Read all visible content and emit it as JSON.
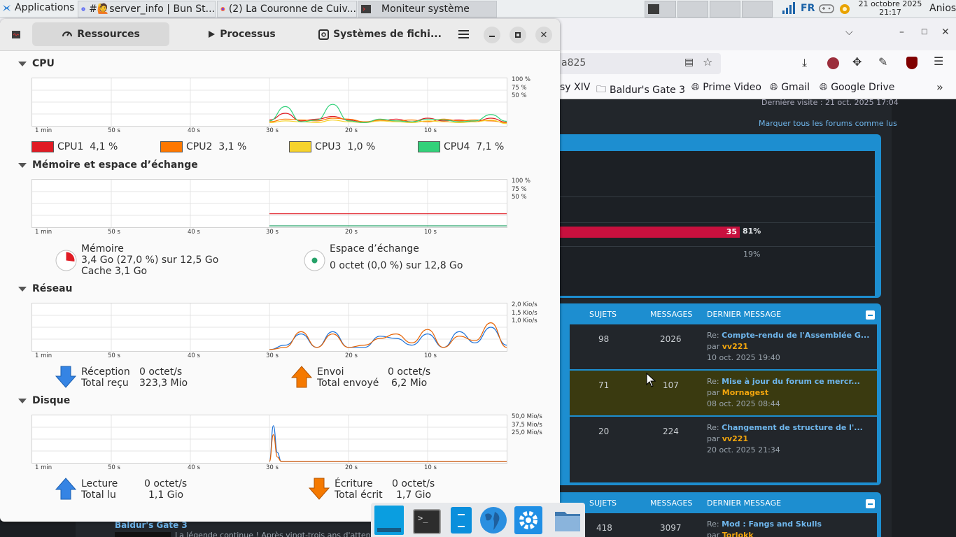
{
  "top_panel": {
    "applications_label": "Applications",
    "tasks": [
      {
        "label": "#🙋server_info | Bun St...",
        "icon": "discord-icon"
      },
      {
        "label": "(2) La Couronne de Cuiv...",
        "icon": "firefox-icon"
      },
      {
        "label": "Moniteur système",
        "icon": "terminal-icon"
      }
    ],
    "keyboard_layout": "FR",
    "clock_date": "21 octobre 2025",
    "clock_time": "21:17",
    "user_name": "Anios"
  },
  "firefox": {
    "url_fragment": "a825",
    "bookmarks": [
      "sy XIV",
      "Baldur's Gate 3",
      "Prime Video",
      "Gmail",
      "Google Drive"
    ],
    "last_visit": "Dernière visite : 21 oct. 2025 17:04",
    "mark_all_read": "Marquer tous les forums comme lus",
    "poll": [
      {
        "count": "35",
        "percent": "81%"
      },
      {
        "percent": "19%"
      }
    ],
    "headers": {
      "topics": "SUJETS",
      "messages": "MESSAGES",
      "last_message": "DERNIER MESSAGE"
    },
    "forum_rows": [
      {
        "topics": "98",
        "messages": "2026",
        "prefix": "Re:",
        "title": "Compte-rendu de l'Assemblée G...",
        "by": "par",
        "author": "vv221",
        "date": "10 oct. 2025 19:40"
      },
      {
        "topics": "71",
        "messages": "107",
        "prefix": "Re:",
        "title": "Mise à jour du forum ce mercr...",
        "by": "par",
        "author": "Mornagest",
        "date": "08 oct. 2025 08:44"
      },
      {
        "topics": "20",
        "messages": "224",
        "prefix": "Re:",
        "title": "Changement de structure de l'...",
        "by": "par",
        "author": "vv221",
        "date": "20 oct. 2025 21:34"
      }
    ],
    "second_block": {
      "topics": "418",
      "messages": "3097",
      "prefix": "Re:",
      "title": "Mod : Fangs and Skulls",
      "by": "par",
      "author": "Torlokk"
    },
    "forum_title_bottom": "Baldur's Gate 3",
    "forum_desc_bottom": "La légende continue ! Après vingt-trois ans d'attente, un..."
  },
  "sysmon": {
    "tabs": [
      {
        "label": "Ressources",
        "icon": "gauge-icon",
        "selected": true
      },
      {
        "label": "Processus",
        "icon": "play-icon",
        "selected": false
      },
      {
        "label": "Systèmes de fichi...",
        "icon": "disk-icon",
        "selected": false
      }
    ],
    "time_labels": [
      "1 min",
      "50 s",
      "40 s",
      "30 s",
      "20 s",
      "10 s"
    ],
    "cpu": {
      "title": "CPU",
      "y_labels": [
        "100 %",
        "75 %",
        "50 %"
      ],
      "legend": [
        {
          "name": "CPU1",
          "value": "4,1 %",
          "color": "#e01b24"
        },
        {
          "name": "CPU2",
          "value": "3,1 %",
          "color": "#ff7800"
        },
        {
          "name": "CPU3",
          "value": "1,0 %",
          "color": "#f6d32d"
        },
        {
          "name": "CPU4",
          "value": "7,1 %",
          "color": "#33d17a"
        }
      ]
    },
    "memory": {
      "title": "Mémoire et espace d’échange",
      "y_labels": [
        "100 %",
        "75 %",
        "50 %"
      ],
      "mem_label": "Mémoire",
      "mem_usage": "3,4 Go (27,0 %) sur 12,5 Go",
      "mem_cache": "Cache 3,1 Go",
      "mem_fraction": 0.27,
      "swap_label": "Espace d’échange",
      "swap_usage": "0 octet (0,0 %) sur 12,8 Go",
      "mem_color": "#e01b24",
      "swap_color": "#26a269"
    },
    "network": {
      "title": "Réseau",
      "y_labels": [
        "2,0 Kio/s",
        "1,5 Kio/s",
        "1,0 Kio/s"
      ],
      "rx_label": "Réception",
      "rx_rate": "0 octet/s",
      "rx_total_label": "Total reçu",
      "rx_total": "323,3 Mio",
      "tx_label": "Envoi",
      "tx_rate": "0 octet/s",
      "tx_total_label": "Total envoyé",
      "tx_total": "6,2 Mio"
    },
    "disk": {
      "title": "Disque",
      "y_labels": [
        "50,0 Mio/s",
        "37,5 Mio/s",
        "25,0 Mio/s"
      ],
      "read_label": "Lecture",
      "read_rate": "0 octet/s",
      "read_total_label": "Total lu",
      "read_total": "1,1 Gio",
      "write_label": "Écriture",
      "write_rate": "0 octet/s",
      "write_total_label": "Total écrit",
      "write_total": "1,7 Gio"
    }
  },
  "chart_data": [
    {
      "type": "line",
      "title": "CPU",
      "xlabel": "",
      "ylabel": "",
      "x": [
        -30,
        -28,
        -26,
        -24,
        -22,
        -20,
        -18,
        -16,
        -14,
        -12,
        -10,
        -8,
        -6,
        -4,
        -2,
        0
      ],
      "ylim": [
        0,
        100
      ],
      "series": [
        {
          "name": "CPU1",
          "color": "#e01b24",
          "values": [
            10,
            25,
            8,
            12,
            18,
            10,
            6,
            8,
            12,
            6,
            14,
            8,
            10,
            6,
            14,
            5
          ]
        },
        {
          "name": "CPU2",
          "color": "#ff7800",
          "values": [
            6,
            12,
            10,
            8,
            14,
            12,
            6,
            10,
            8,
            10,
            6,
            12,
            8,
            10,
            8,
            4
          ]
        },
        {
          "name": "CPU3",
          "color": "#f6d32d",
          "values": [
            4,
            8,
            6,
            4,
            10,
            6,
            4,
            8,
            6,
            4,
            8,
            6,
            4,
            6,
            10,
            2
          ]
        },
        {
          "name": "CPU4",
          "color": "#33d17a",
          "values": [
            8,
            40,
            6,
            10,
            45,
            8,
            4,
            12,
            8,
            6,
            12,
            10,
            6,
            8,
            22,
            7
          ]
        }
      ]
    },
    {
      "type": "line",
      "title": "Mémoire et espace d’échange",
      "xlabel": "",
      "ylabel": "",
      "x": [
        -30,
        0
      ],
      "ylim": [
        0,
        100
      ],
      "series": [
        {
          "name": "Mémoire",
          "color": "#e01b24",
          "values": [
            27,
            27
          ]
        },
        {
          "name": "Espace d’échange",
          "color": "#26a269",
          "values": [
            0,
            0
          ]
        }
      ]
    },
    {
      "type": "line",
      "title": "Réseau",
      "xlabel": "",
      "ylabel": "",
      "x": [
        -30,
        -28,
        -26,
        -24,
        -22,
        -20,
        -18,
        -16,
        -14,
        -12,
        -10,
        -8,
        -6,
        -4,
        -2,
        0
      ],
      "ylim": [
        0,
        2.0
      ],
      "series": [
        {
          "name": "Réception",
          "color": "#1c71d8",
          "values": [
            0,
            0.2,
            0.7,
            0.1,
            0.8,
            0.1,
            0.1,
            0.6,
            0.5,
            0.2,
            0.7,
            0.1,
            0.8,
            0.3,
            1.0,
            0.2
          ]
        },
        {
          "name": "Envoi",
          "color": "#e66100",
          "values": [
            0,
            0.1,
            0.8,
            0.1,
            0.7,
            0.1,
            0.2,
            0.5,
            0.7,
            0.3,
            0.9,
            0.1,
            0.6,
            0.4,
            1.2,
            0.1
          ]
        }
      ]
    },
    {
      "type": "line",
      "title": "Disque",
      "xlabel": "",
      "ylabel": "",
      "x": [
        -30,
        -29.5,
        -29,
        -28.5,
        -28,
        -20,
        -10,
        0
      ],
      "ylim": [
        0,
        50
      ],
      "series": [
        {
          "name": "Lecture",
          "color": "#1c71d8",
          "values": [
            0,
            40,
            10,
            0,
            0,
            0,
            0,
            0
          ]
        },
        {
          "name": "Écriture",
          "color": "#e66100",
          "values": [
            0,
            30,
            5,
            0,
            0,
            0,
            0,
            0
          ]
        }
      ]
    }
  ]
}
